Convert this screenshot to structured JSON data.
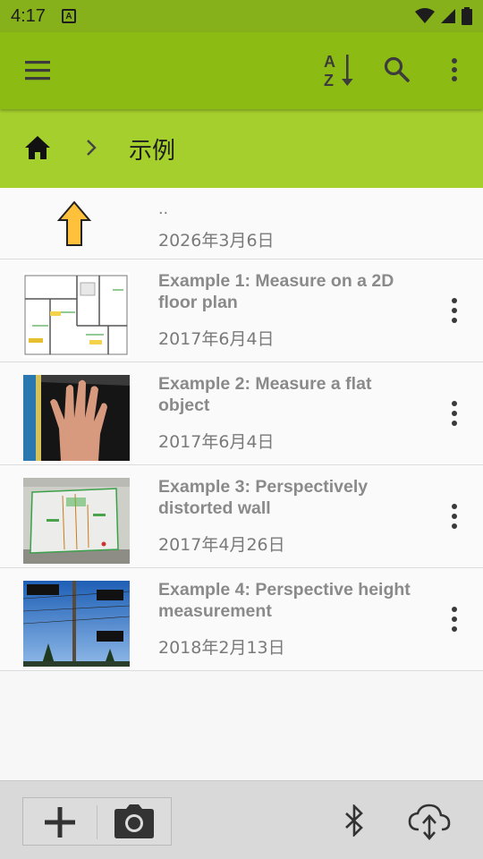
{
  "status_bar": {
    "time": "4:17",
    "badge_letter": "A",
    "icons": [
      "wifi-icon",
      "signal-icon",
      "battery-icon"
    ]
  },
  "app_bar": {
    "icons": [
      "menu-icon",
      "sort-az-icon",
      "search-icon",
      "more-vert-icon"
    ],
    "sort_letters": [
      "A",
      "Z"
    ],
    "color": "#8cbc14"
  },
  "breadcrumb": {
    "current_folder": "示例",
    "color": "#a5cf2c"
  },
  "parent_row": {
    "name": "..",
    "date": "2026年3月6日"
  },
  "items": [
    {
      "title": "Example 1: Measure on a 2D floor plan",
      "date": "2017年6月4日",
      "thumb": "floor-plan-thumbnail"
    },
    {
      "title": "Example 2: Measure a flat object",
      "date": "2017年6月4日",
      "thumb": "hand-photo-thumbnail"
    },
    {
      "title": "Example 3: Perspectively distorted wall",
      "date": "2017年4月26日",
      "thumb": "wall-photo-thumbnail"
    },
    {
      "title": "Example 4: Perspective height measurement",
      "date": "2018年2月13日",
      "thumb": "pole-photo-thumbnail"
    }
  ],
  "bottom_bar": {
    "icons": [
      "add-icon",
      "camera-icon",
      "bluetooth-icon",
      "cloud-sync-icon"
    ]
  }
}
